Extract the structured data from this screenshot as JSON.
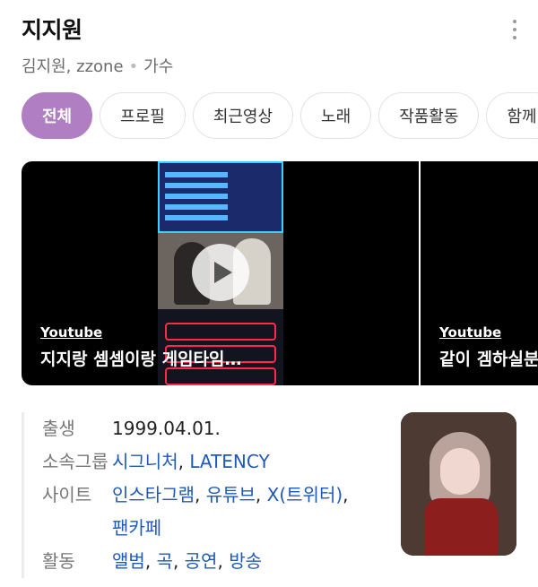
{
  "header": {
    "title": "지지원",
    "aliases": "김지원, zzone",
    "dot": "•",
    "occupation": "가수"
  },
  "tabs": [
    {
      "label": "전체",
      "active": true
    },
    {
      "label": "프로필"
    },
    {
      "label": "최근영상"
    },
    {
      "label": "노래"
    },
    {
      "label": "작품활동"
    },
    {
      "label": "함께"
    }
  ],
  "videos": [
    {
      "source": "Youtube",
      "title": "지지랑 셈셈이랑 게임타임…"
    },
    {
      "source": "Youtube",
      "title": "같이 겜하실분"
    }
  ],
  "info": {
    "birth_label": "출생",
    "birth_value": "1999.04.01.",
    "group_label": "소속그룹",
    "groups": [
      "시그니처",
      "LATENCY"
    ],
    "site_label": "사이트",
    "sites": [
      "인스타그램",
      "유튜브",
      "X(트위터)",
      "팬카페"
    ],
    "activity_label": "활동",
    "activities": [
      "앨범",
      "곡",
      "공연",
      "방송"
    ],
    "sep": ", "
  },
  "colors": {
    "accent": "#b07ec2",
    "link": "#1f59b8"
  }
}
